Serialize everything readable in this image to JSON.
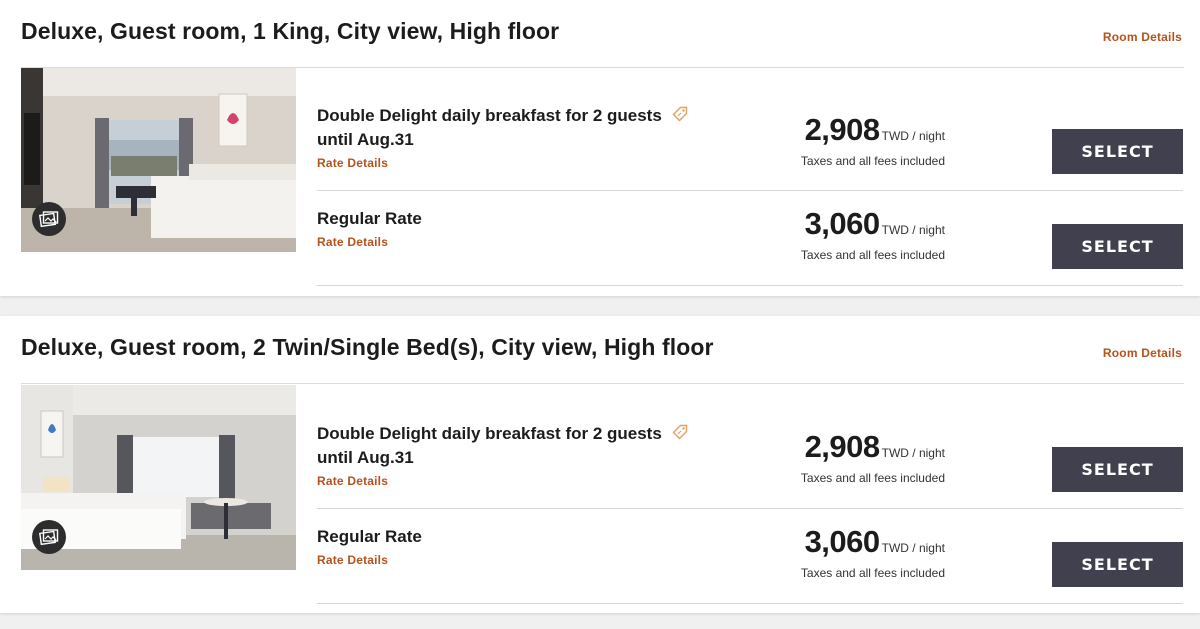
{
  "rooms": [
    {
      "title": "Deluxe, Guest room, 1 King, City view, High floor",
      "details_link": "Room Details",
      "photo_icon": "gallery-icon",
      "rates": [
        {
          "name_line1": "Double Delight daily breakfast for 2 guests",
          "name_line2": "until Aug.31",
          "has_tag_icon": true,
          "details_link": "Rate Details",
          "price": "2,908",
          "unit": "TWD / night",
          "note": "Taxes and all fees included",
          "button": "SELECT"
        },
        {
          "name_line1": "Regular Rate",
          "details_link": "Rate Details",
          "price": "3,060",
          "unit": "TWD / night",
          "note": "Taxes and all fees included",
          "button": "SELECT"
        }
      ]
    },
    {
      "title": "Deluxe, Guest room, 2 Twin/Single Bed(s), City view, High floor",
      "details_link": "Room Details",
      "photo_icon": "gallery-icon",
      "rates": [
        {
          "name_line1": "Double Delight daily breakfast for 2 guests",
          "name_line2": "until Aug.31",
          "has_tag_icon": true,
          "details_link": "Rate Details",
          "price": "2,908",
          "unit": "TWD / night",
          "note": "Taxes and all fees included",
          "button": "SELECT"
        },
        {
          "name_line1": "Regular Rate",
          "details_link": "Rate Details",
          "price": "3,060",
          "unit": "TWD / night",
          "note": "Taxes and all fees included",
          "button": "SELECT"
        }
      ]
    }
  ],
  "colors": {
    "accent_link": "#b5521d",
    "select_button_bg": "#40404f",
    "page_bg": "#f0f0f0"
  }
}
